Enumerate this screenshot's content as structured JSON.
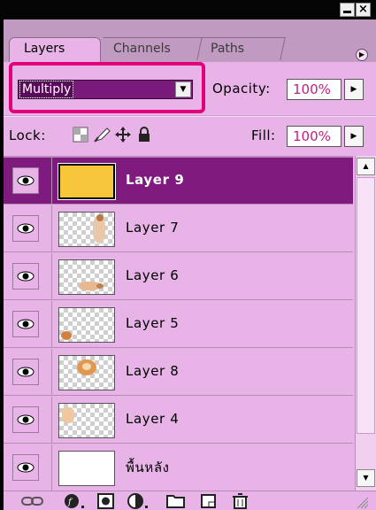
{
  "tabs": [
    {
      "label": "Layers",
      "active": true
    },
    {
      "label": "Channels",
      "active": false
    },
    {
      "label": "Paths",
      "active": false
    }
  ],
  "blend_mode": "Multiply",
  "opacity": {
    "label": "Opacity:",
    "value": "100%"
  },
  "lock": {
    "label": "Lock:"
  },
  "fill": {
    "label": "Fill:",
    "value": "100%"
  },
  "layers": [
    {
      "name": "Layer 9",
      "selected": true,
      "visible": true
    },
    {
      "name": "Layer 7",
      "selected": false,
      "visible": true
    },
    {
      "name": "Layer 6",
      "selected": false,
      "visible": true
    },
    {
      "name": "Layer 5",
      "selected": false,
      "visible": true
    },
    {
      "name": "Layer 8",
      "selected": false,
      "visible": true
    },
    {
      "name": "Layer 4",
      "selected": false,
      "visible": true
    },
    {
      "name": "พื้นหลัง",
      "selected": false,
      "visible": true
    }
  ],
  "colors": {
    "panel_bg": "#e8b4e8",
    "selected_row": "#7f1a7f",
    "highlight_box": "#e2007a",
    "layer9_fill": "#f7c63a"
  },
  "toolbar_icons": [
    "link-layers-icon",
    "layer-style-icon",
    "layer-mask-icon",
    "adjustment-layer-icon",
    "new-group-icon",
    "new-layer-icon",
    "trash-icon"
  ]
}
